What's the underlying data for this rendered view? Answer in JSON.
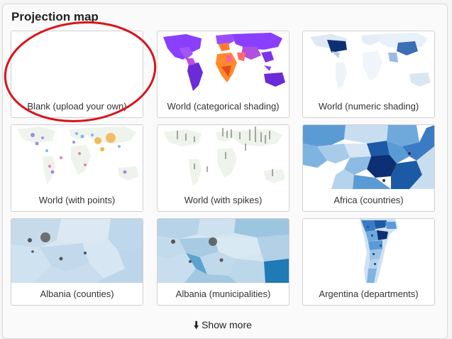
{
  "section": {
    "title": "Projection map"
  },
  "cards": [
    {
      "label": "Blank (upload your own)"
    },
    {
      "label": "World (categorical shading)"
    },
    {
      "label": "World (numeric shading)"
    },
    {
      "label": "World (with points)"
    },
    {
      "label": "World (with spikes)"
    },
    {
      "label": "Africa (countries)"
    },
    {
      "label": "Albania (counties)"
    },
    {
      "label": "Albania (municipalities)"
    },
    {
      "label": "Argentina (departments)"
    }
  ],
  "show_more": {
    "label": "Show more",
    "icon": "arrow-down-icon"
  },
  "colors": {
    "annotation_circle": "#d9141c",
    "categorical_purple": "#8a3ffc",
    "numeric_blue": "#1c4f9c"
  }
}
